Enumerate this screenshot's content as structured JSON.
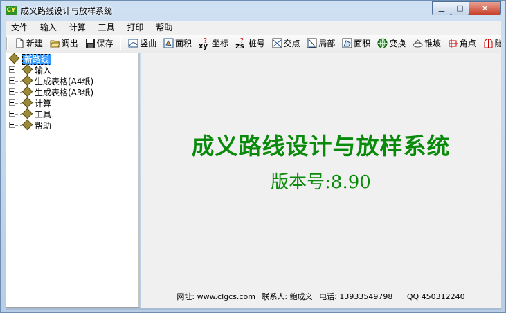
{
  "window": {
    "title": "成义路线设计与放样系统",
    "app_icon_text": "CY",
    "controls": {
      "minimize": "▁",
      "maximize": "□",
      "close": "✕"
    }
  },
  "menu": [
    "文件",
    "输入",
    "计算",
    "工具",
    "打印",
    "帮助"
  ],
  "toolbar": {
    "groups": [
      [
        {
          "label": "新建",
          "icon": "new-file-icon"
        },
        {
          "label": "调出",
          "icon": "open-folder-icon"
        },
        {
          "label": "保存",
          "icon": "save-disk-icon"
        }
      ],
      [
        {
          "label": "竖曲",
          "icon": "vertical-curve-icon"
        },
        {
          "label": "面积",
          "icon": "area-icon"
        },
        {
          "label": "坐标",
          "icon": "xy-coordinate-icon",
          "glyph": "xy"
        },
        {
          "label": "桩号",
          "icon": "zs-stake-icon",
          "glyph": "zs"
        },
        {
          "label": "交点",
          "icon": "intersection-icon"
        },
        {
          "label": "局部",
          "icon": "local-icon"
        },
        {
          "label": "面积",
          "icon": "area2-icon"
        },
        {
          "label": "变换",
          "icon": "transform-globe-icon"
        },
        {
          "label": "锥坡",
          "icon": "cone-slope-icon"
        },
        {
          "label": "角点",
          "icon": "corner-point-icon"
        },
        {
          "label": "隧",
          "icon": "tunnel-icon"
        }
      ]
    ]
  },
  "tree": {
    "root": "新路线",
    "nodes": [
      "输入",
      "生成表格(A4纸)",
      "生成表格(A3纸)",
      "计算",
      "工具",
      "帮助"
    ]
  },
  "main": {
    "title": "成义路线设计与放样系统",
    "version": "版本号:8.90",
    "contact": {
      "website": "网址: www.clgcs.com",
      "person": "联系人: 鲍成义",
      "phone": "电话: 13933549798",
      "qq": "QQ 450312240"
    }
  },
  "colors": {
    "title_green": "#0a8a0a",
    "selection_blue": "#3399ff",
    "close_red": "#c7402a"
  }
}
